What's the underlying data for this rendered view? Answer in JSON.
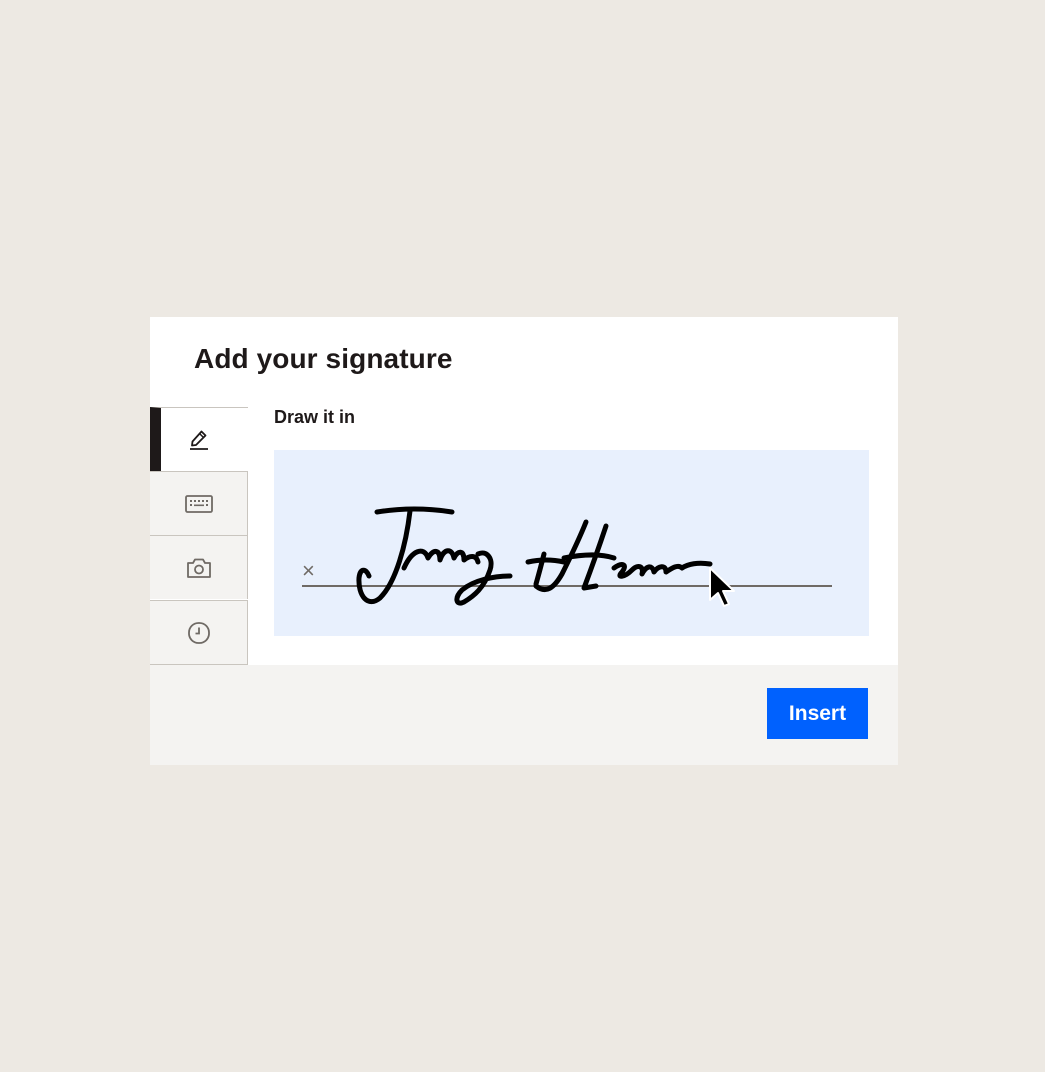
{
  "dialog": {
    "title": "Add your signature",
    "section_label": "Draw it in",
    "tabs": [
      {
        "name": "draw",
        "icon": "pencil-icon",
        "active": true
      },
      {
        "name": "type",
        "icon": "keyboard-icon",
        "active": false
      },
      {
        "name": "upload",
        "icon": "camera-icon",
        "active": false
      },
      {
        "name": "recent",
        "icon": "clock-icon",
        "active": false
      }
    ],
    "signature_pad": {
      "x_mark": "×"
    },
    "insert_label": "Insert"
  },
  "colors": {
    "background": "#EDE9E3",
    "dialog": "#FFFFFF",
    "pad": "#E8F0FD",
    "accent": "#0061FE",
    "text": "#1E1919",
    "footer": "#F4F3F1"
  }
}
